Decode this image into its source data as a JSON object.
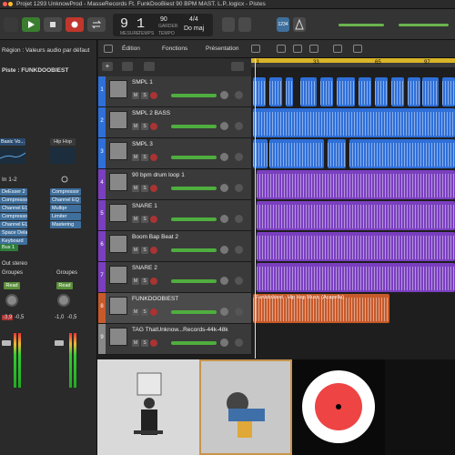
{
  "window": {
    "title": "Projet 1293 UnknowProd - MasseRecords Ft. FunkDooBiest 90 BPM MAST. L.P..logicx - Pistes"
  },
  "control_bar": {
    "position": "9 1",
    "tempo": "90",
    "tempo_label": "GARDER",
    "signature": "4/4",
    "key": "Do maj",
    "bar_label": "MESURE",
    "beat_label": "TEMPS",
    "tempo_caption": "TEMPO",
    "count_in": "1234"
  },
  "inspector": {
    "region_label": "Région : Valeurs audio par défaut",
    "track_label": "Piste : FUNKDOOBIEST",
    "eq_left": "Basic Vo...",
    "eq_right": "Hip Hop",
    "input": "In 1-2",
    "plugins_left": [
      "DeEsser 2",
      "Compressor",
      "Channel EQ",
      "Compressor",
      "Channel EQ",
      "Space Delay",
      "Keyboard"
    ],
    "plugins_right": [
      "Compressor",
      "Channel EQ",
      "Multipr",
      "Limiter",
      "Mastering"
    ],
    "send": "Bus 1",
    "output": "Out stereo",
    "group_label_left": "Groupes",
    "group_label_right": "Groupes",
    "read_left": "Read",
    "read_right": "Read",
    "value_left": "-3,9",
    "value_left2": "-0,5",
    "value_right": "-1,0",
    "value_right2": "-0,5"
  },
  "menus": {
    "edition": "Édition",
    "fonctions": "Fonctions",
    "presentation": "Présentation"
  },
  "ruler": {
    "marks": [
      "1",
      "33",
      "65",
      "97"
    ]
  },
  "tracks": [
    {
      "num": "1",
      "name": "SMPL 1",
      "color": "#2f6fd8"
    },
    {
      "num": "2",
      "name": "SMPL 2 BASS",
      "color": "#2f6fd8"
    },
    {
      "num": "3",
      "name": "SMPL 3",
      "color": "#2f6fd8"
    },
    {
      "num": "4",
      "name": "90 bpm drum loop 1",
      "color": "#7a3fbf"
    },
    {
      "num": "5",
      "name": "SNARE 1",
      "color": "#7a3fbf"
    },
    {
      "num": "6",
      "name": "Boom Bap Beat 2",
      "color": "#7a3fbf"
    },
    {
      "num": "7",
      "name": "SNARE 2",
      "color": "#7a3fbf"
    },
    {
      "num": "8",
      "name": "FUNKDOOBIEST",
      "color": "#c75a2a"
    },
    {
      "num": "9",
      "name": "TAG ThatUnknow...Records-44k-48k",
      "color": "#888"
    }
  ],
  "region_labels": {
    "funk": "Funkdobiest - Hip Hop Music (Acapella)"
  },
  "colors": {
    "accent": "#2f6fd8",
    "audio": "#7a3fbf",
    "vocal": "#c75a2a",
    "cycle": "#d9b428"
  }
}
